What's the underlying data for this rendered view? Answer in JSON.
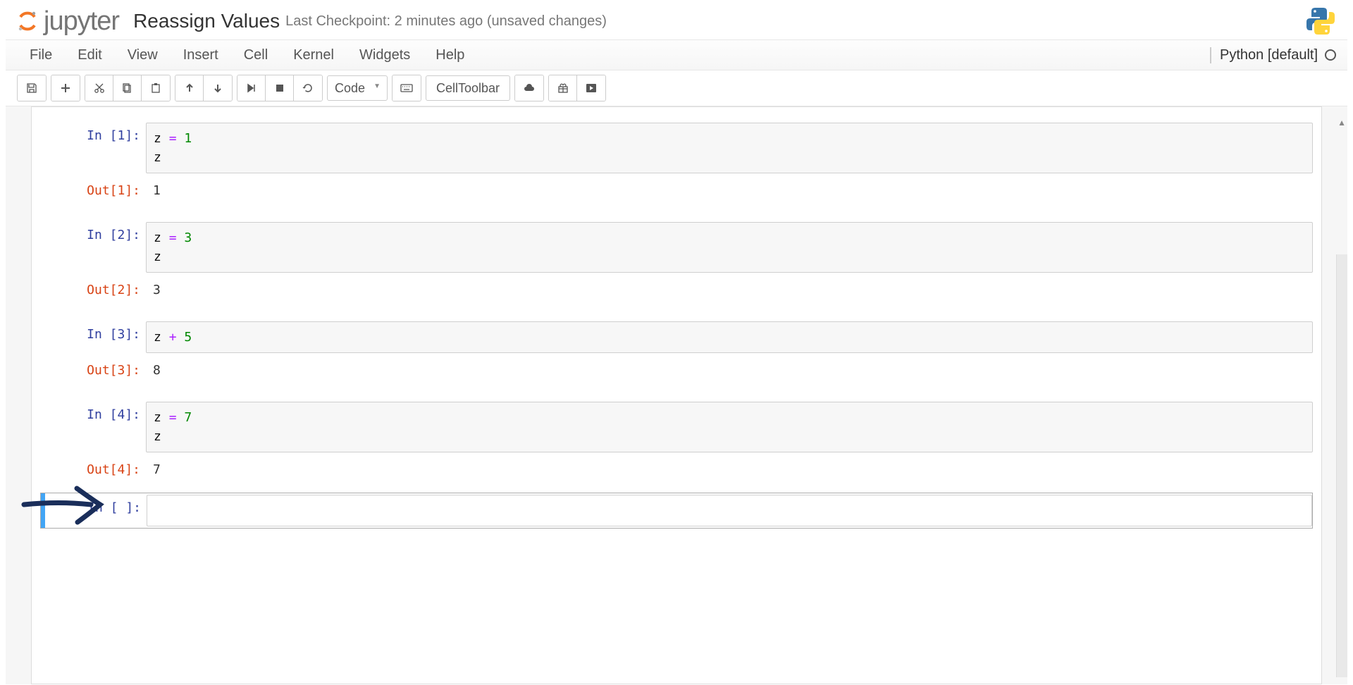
{
  "header": {
    "logo_text": "jupyter",
    "notebook_title": "Reassign Values",
    "checkpoint_text": "Last Checkpoint: 2 minutes ago (unsaved changes)"
  },
  "menubar": {
    "items": [
      "File",
      "Edit",
      "View",
      "Insert",
      "Cell",
      "Kernel",
      "Widgets",
      "Help"
    ],
    "kernel_name": "Python [default]"
  },
  "toolbar": {
    "cell_type_selected": "Code",
    "cell_toolbar_label": "CellToolbar",
    "icons": {
      "save": "save-icon",
      "add": "plus-icon",
      "cut": "cut-icon",
      "copy": "copy-icon",
      "paste": "paste-icon",
      "up": "arrow-up-icon",
      "down": "arrow-down-icon",
      "run": "step-forward-icon",
      "stop": "stop-icon",
      "restart": "refresh-icon",
      "keyboard": "keyboard-icon",
      "cloud": "cloud-upload-icon",
      "gift": "gift-icon",
      "play_rect": "play-in-box-icon"
    }
  },
  "cells": [
    {
      "in_label": "In [1]:",
      "code_lines": [
        "z = 1",
        "z"
      ],
      "out_label": "Out[1]:",
      "out_value": "1"
    },
    {
      "in_label": "In [2]:",
      "code_lines": [
        "z = 3",
        "z"
      ],
      "out_label": "Out[2]:",
      "out_value": "3"
    },
    {
      "in_label": "In [3]:",
      "code_lines": [
        "z + 5"
      ],
      "out_label": "Out[3]:",
      "out_value": "8"
    },
    {
      "in_label": "In [4]:",
      "code_lines": [
        "z = 7",
        "z"
      ],
      "out_label": "Out[4]:",
      "out_value": "7"
    },
    {
      "in_label": "In [ ]:",
      "code_lines": [
        ""
      ],
      "out_label": "",
      "out_value": ""
    }
  ],
  "annotation": {
    "type": "arrow",
    "color": "#1a2e5a",
    "target_cell_index": 3
  }
}
